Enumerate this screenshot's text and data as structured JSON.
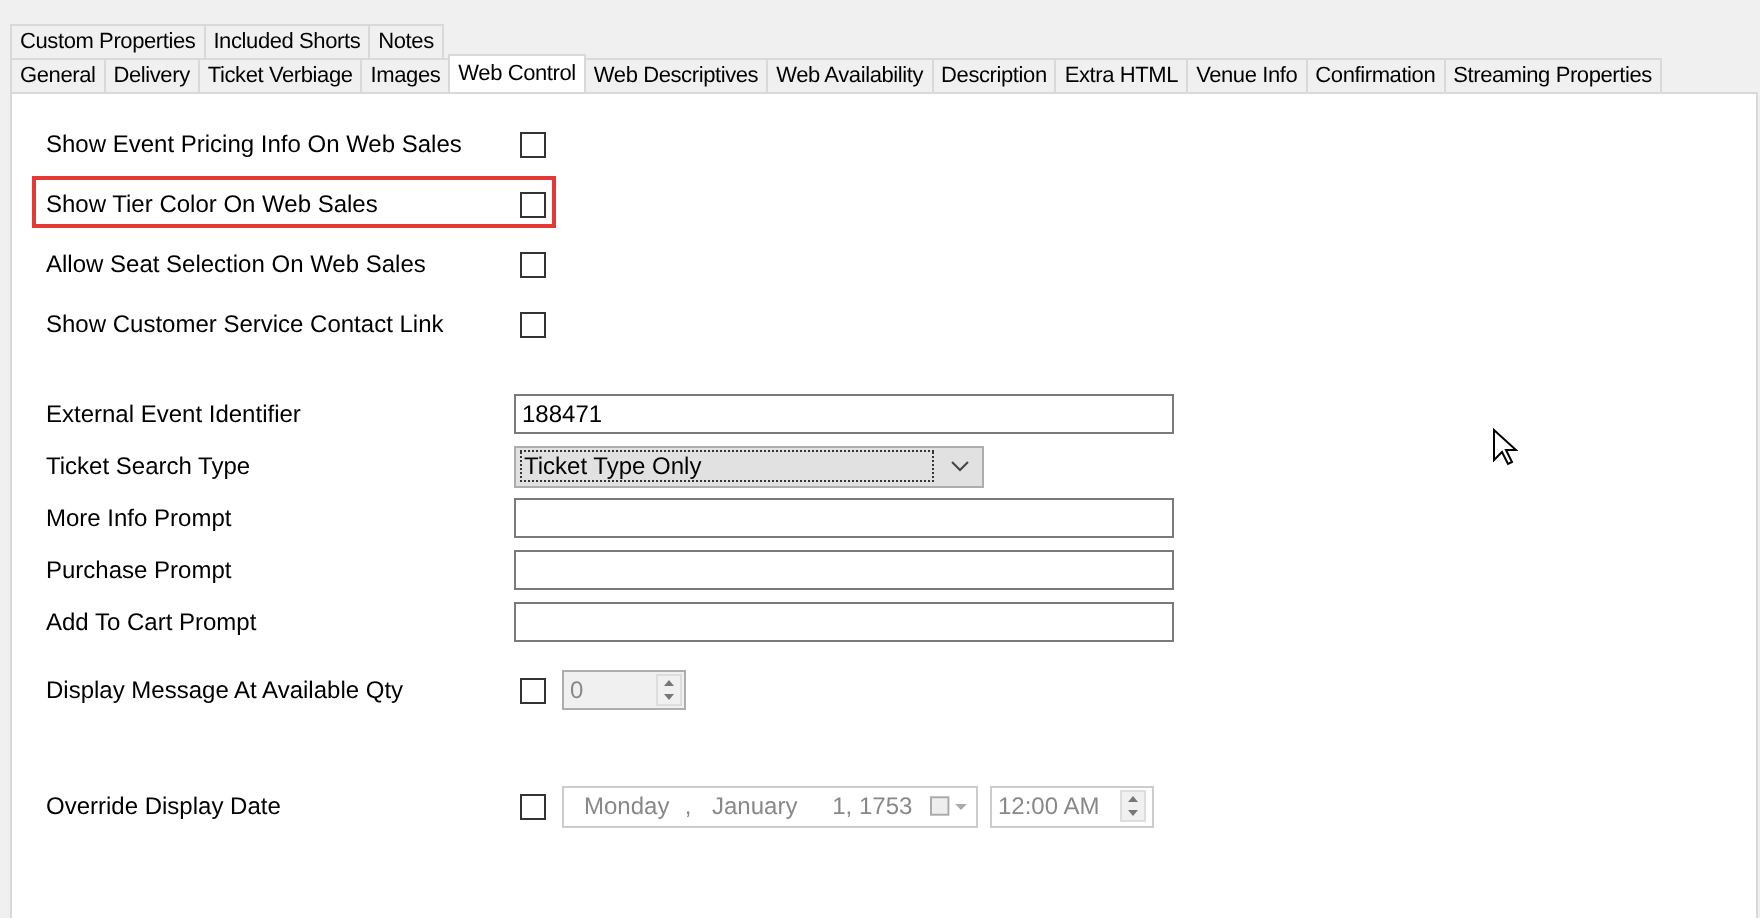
{
  "tabs_row_1": [
    {
      "label": "Custom Properties",
      "selected": false
    },
    {
      "label": "Included Shorts",
      "selected": false
    },
    {
      "label": "Notes",
      "selected": false
    }
  ],
  "tabs_row_2": [
    {
      "label": "General",
      "selected": false
    },
    {
      "label": "Delivery",
      "selected": false
    },
    {
      "label": "Ticket Verbiage",
      "selected": false
    },
    {
      "label": "Images",
      "selected": false
    },
    {
      "label": "Web Control",
      "selected": true
    },
    {
      "label": "Web Descriptives",
      "selected": false
    },
    {
      "label": "Web Availability",
      "selected": false
    },
    {
      "label": "Description",
      "selected": false
    },
    {
      "label": "Extra HTML",
      "selected": false
    },
    {
      "label": "Venue Info",
      "selected": false
    },
    {
      "label": "Confirmation",
      "selected": false
    },
    {
      "label": "Streaming Properties",
      "selected": false
    }
  ],
  "checkbox_rows": [
    {
      "label": "Show Event Pricing Info On Web Sales",
      "checked": false,
      "highlighted": false
    },
    {
      "label": "Show Tier Color On Web Sales",
      "checked": false,
      "highlighted": true
    },
    {
      "label": "Allow Seat Selection On Web Sales",
      "checked": false,
      "highlighted": false
    },
    {
      "label": "Show Customer Service Contact Link",
      "checked": false,
      "highlighted": false
    }
  ],
  "fields": [
    {
      "label": "External Event Identifier",
      "kind": "text",
      "value": "188471"
    },
    {
      "label": "Ticket Search Type",
      "kind": "dropdown",
      "value": "Ticket Type Only"
    },
    {
      "label": "More Info Prompt",
      "kind": "text"
    },
    {
      "label": "Purchase Prompt",
      "kind": "text"
    },
    {
      "label": "Add To Cart Prompt",
      "kind": "text"
    }
  ],
  "available_qty": {
    "label": "Display Message At Available Qty",
    "checked": false,
    "value": "0",
    "disabled": true
  },
  "override_date": {
    "label": "Override Display Date",
    "checked": false,
    "disabled": true,
    "weekday": "Monday",
    "separator": ",",
    "month": "January",
    "day_year": "1, 1753",
    "time": "12:00 AM"
  }
}
